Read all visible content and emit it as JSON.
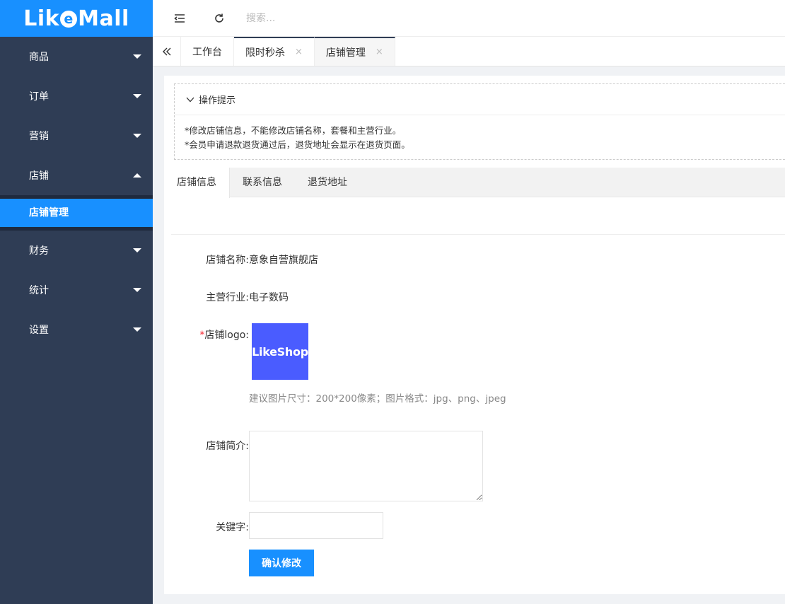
{
  "sidebar": {
    "logo": {
      "part1": "Lik",
      "part2": "e",
      "part3": "Mall"
    },
    "menu": [
      {
        "label": "商品",
        "expanded": false
      },
      {
        "label": "订单",
        "expanded": false
      },
      {
        "label": "营销",
        "expanded": false
      },
      {
        "label": "店铺",
        "expanded": true
      },
      {
        "label": "财务",
        "expanded": false
      },
      {
        "label": "统计",
        "expanded": false
      },
      {
        "label": "设置",
        "expanded": false
      }
    ],
    "submenu_active": "店铺管理"
  },
  "topbar": {
    "search_placeholder": "搜索..."
  },
  "tabs": [
    {
      "label": "工作台",
      "closable": false
    },
    {
      "label": "限时秒杀",
      "closable": true,
      "close": "×"
    },
    {
      "label": "店铺管理",
      "closable": true,
      "close": "×",
      "active": true
    }
  ],
  "tips": {
    "title": "操作提示",
    "lines": [
      "*修改店铺信息，不能修改店铺名称，套餐和主营行业。",
      "*会员申请退款退货通过后，退货地址会显示在退货页面。"
    ]
  },
  "subtabs": [
    "店铺信息",
    "联系信息",
    "退货地址"
  ],
  "form": {
    "name_label": "店铺名称:",
    "name_value": "意象自营旗舰店",
    "industry_label": "主营行业:",
    "industry_value": "电子数码",
    "logo_required": "*",
    "logo_label": "店铺logo:",
    "logo_text": "LikeShop",
    "logo_hint": "建议图片尺寸：200*200像素；图片格式：jpg、png、jpeg",
    "intro_label": "店铺简介:",
    "intro_value": "",
    "keyword_label": "关键字:",
    "keyword_value": "",
    "submit_label": "确认修改"
  },
  "colors": {
    "sidebar": "#2f3d55",
    "accent": "#1890ff",
    "logo_bg": "#4a5cff"
  }
}
